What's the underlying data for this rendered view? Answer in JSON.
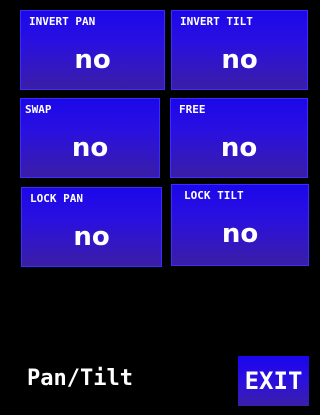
{
  "tiles": [
    {
      "label": "INVERT PAN",
      "value": "no"
    },
    {
      "label": "INVERT TILT",
      "value": "no"
    },
    {
      "label": "SWAP",
      "value": "no"
    },
    {
      "label": "FREE",
      "value": "no"
    },
    {
      "label": "LOCK PAN",
      "value": "no"
    },
    {
      "label": "LOCK TILT",
      "value": "no"
    }
  ],
  "footer": {
    "title": "Pan/Tilt",
    "exit_label": "EXIT"
  },
  "colors": {
    "background": "#000000",
    "tile": "#2a10e0",
    "text": "#ffffff"
  }
}
